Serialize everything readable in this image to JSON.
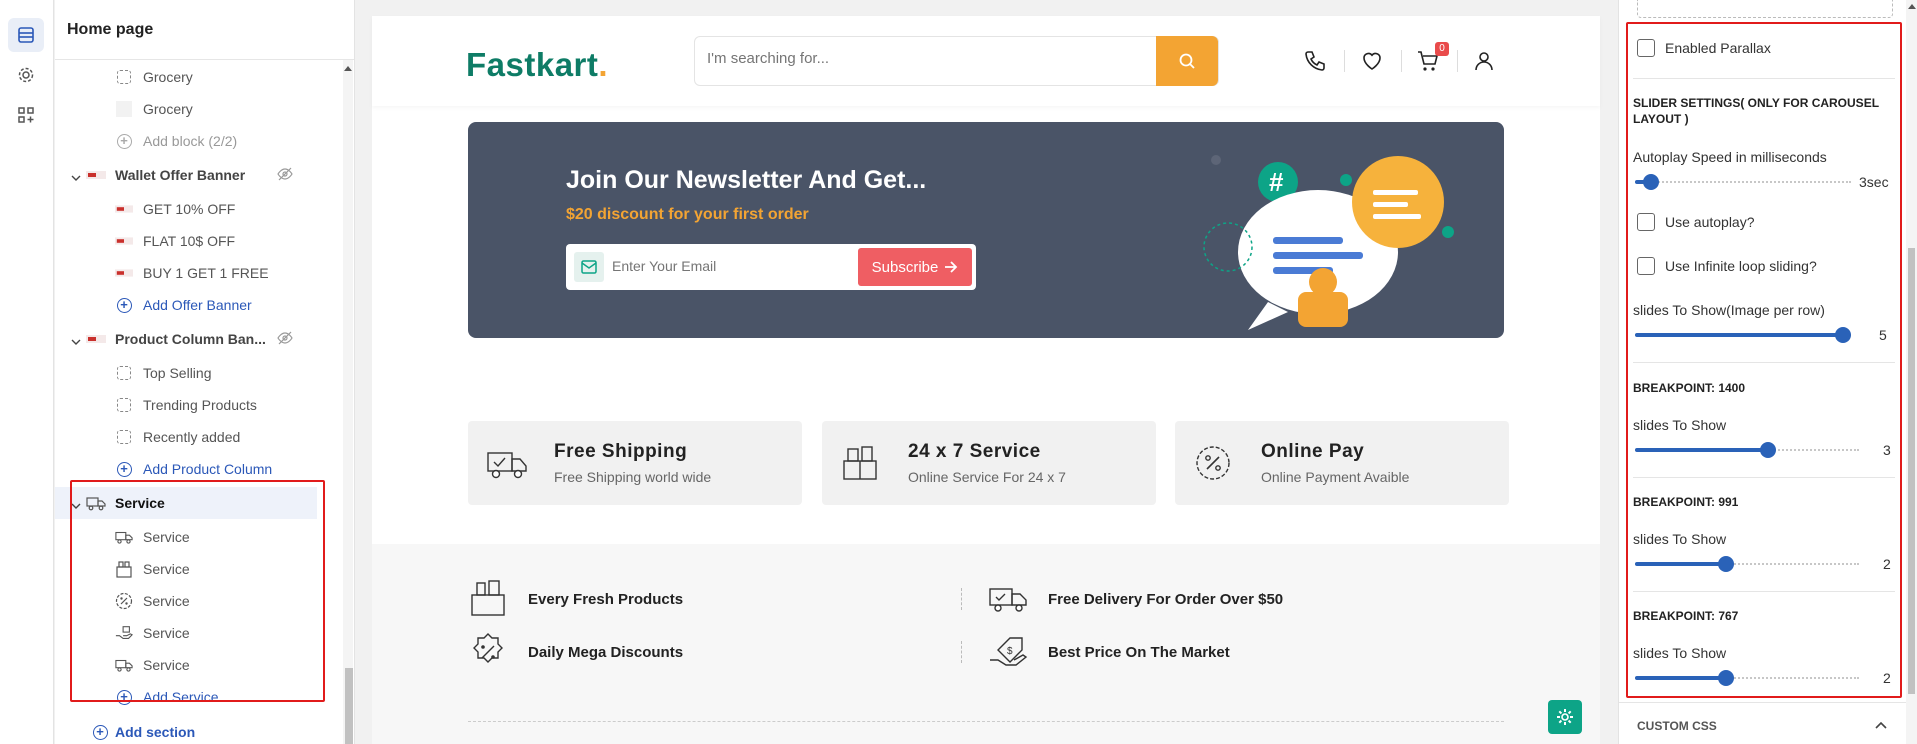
{
  "sidebar": {
    "title": "Home page",
    "rows": [
      {
        "kind": "block",
        "icon": "dashed",
        "label": "Grocery"
      },
      {
        "kind": "block",
        "icon": "blank",
        "label": "Grocery"
      },
      {
        "kind": "add-disabled",
        "label": "Add block (2/2)"
      },
      {
        "kind": "section",
        "label": "Wallet Offer Banner",
        "hidden": true
      },
      {
        "kind": "block",
        "icon": "thumb",
        "label": "GET 10% OFF"
      },
      {
        "kind": "block",
        "icon": "thumb",
        "label": "FLAT 10$ OFF"
      },
      {
        "kind": "block",
        "icon": "thumb",
        "label": "BUY 1 GET 1 FREE"
      },
      {
        "kind": "add",
        "label": "Add Offer Banner"
      },
      {
        "kind": "section",
        "label": "Product Column Ban...",
        "hidden": true
      },
      {
        "kind": "block",
        "icon": "dashed",
        "label": "Top Selling"
      },
      {
        "kind": "block",
        "icon": "dashed",
        "label": "Trending Products"
      },
      {
        "kind": "block",
        "icon": "dashed",
        "label": "Recently added"
      },
      {
        "kind": "add",
        "label": "Add Product Column"
      },
      {
        "kind": "section-active",
        "label": "Service"
      },
      {
        "kind": "block",
        "icon": "truck",
        "label": "Service"
      },
      {
        "kind": "block",
        "icon": "box",
        "label": "Service"
      },
      {
        "kind": "block",
        "icon": "percent",
        "label": "Service"
      },
      {
        "kind": "block",
        "icon": "hand",
        "label": "Service"
      },
      {
        "kind": "block",
        "icon": "truck",
        "label": "Service"
      },
      {
        "kind": "add",
        "label": "Add Service"
      }
    ],
    "add_section": "Add section"
  },
  "header": {
    "logo_text": "Fastkart",
    "logo_dot": ".",
    "search_placeholder": "I'm searching for...",
    "cart_count": "0"
  },
  "newsletter": {
    "title": "Join Our Newsletter And Get...",
    "subtitle": "$20 discount for your first order",
    "email_placeholder": "Enter Your Email",
    "button": "Subscribe"
  },
  "services": [
    {
      "title": "Free Shipping",
      "subtitle": "Free Shipping world wide",
      "icon": "truck-icon"
    },
    {
      "title": "24 x 7 Service",
      "subtitle": "Online Service For 24 x 7",
      "icon": "package-icon"
    },
    {
      "title": "Online Pay",
      "subtitle": "Online Payment Avaible",
      "icon": "percent-badge-icon"
    }
  ],
  "features": [
    {
      "label": "Every Fresh Products",
      "icon": "grocery-box-icon"
    },
    {
      "label": "Free Delivery For Order Over $50",
      "icon": "delivery-truck-icon"
    },
    {
      "label": "Daily Mega Discounts",
      "icon": "discount-badge-icon"
    },
    {
      "label": "Best Price On The Market",
      "icon": "price-tag-icon"
    }
  ],
  "settings": {
    "parallax_label": "Enabled Parallax",
    "slider_heading": "SLIDER SETTINGS( ONLY FOR CAROUSEL LAYOUT )",
    "autoplay_speed_label": "Autoplay Speed in milliseconds",
    "autoplay_speed_value": "3sec",
    "autoplay_speed_level": 0.04,
    "use_autoplay_label": "Use autoplay?",
    "infinite_loop_label": "Use Infinite loop sliding?",
    "slides_to_show_label": "slides To Show(Image per row)",
    "slides_to_show_value": "5",
    "slides_to_show_level": 1.0,
    "breakpoints": [
      {
        "heading": "BREAKPOINT: 1400",
        "label": "slides To Show",
        "value": "3",
        "level": 0.6
      },
      {
        "heading": "BREAKPOINT: 991",
        "label": "slides To Show",
        "value": "2",
        "level": 0.4
      },
      {
        "heading": "BREAKPOINT: 767",
        "label": "slides To Show",
        "value": "2",
        "level": 0.4
      }
    ],
    "custom_css_label": "CUSTOM CSS"
  },
  "colors": {
    "brand_green": "#0e7c66",
    "accent_orange": "#f3a433",
    "subscribe_red": "#ef5e63",
    "link_blue": "#2b58b8",
    "slider_blue": "#2a62b8",
    "highlight_red": "#e11b1b"
  }
}
